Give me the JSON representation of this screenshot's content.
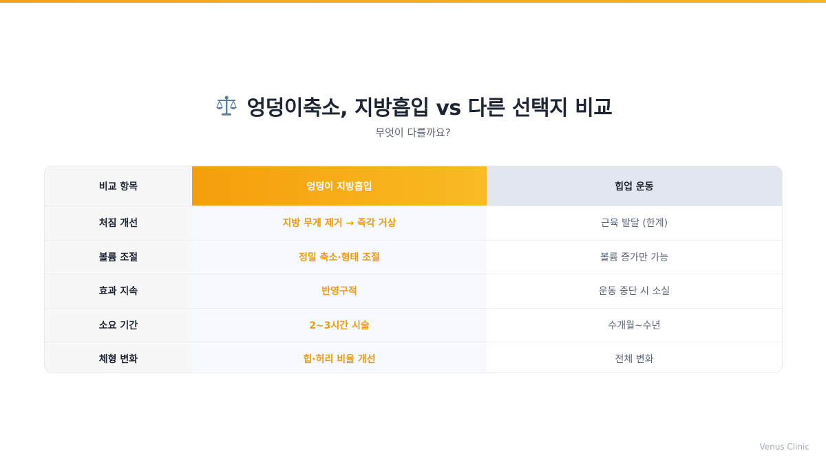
{
  "header": {
    "title": "엉덩이축소, 지방흡입 vs 다른 선택지 비교",
    "title_icon": "scale-icon",
    "subtitle": "무엇이 다를까요?"
  },
  "table": {
    "columns": [
      "비교 항목",
      "엉덩이 지방흡입",
      "힙업 운동"
    ],
    "rows": [
      [
        "처짐 개선",
        "지방 무게 제거 → 즉각 거상",
        "근육 발달 (한계)"
      ],
      [
        "볼륨 조절",
        "정밀 축소·형태 조절",
        "볼륨 증가만 가능"
      ],
      [
        "효과 지속",
        "반영구적",
        "운동 중단 시 소실"
      ],
      [
        "소요 기간",
        "2~3시간 시술",
        "수개월~수년"
      ],
      [
        "체형 변화",
        "힙·허리 비율 개선",
        "전체 변화"
      ]
    ]
  },
  "footer": {
    "brand": "Venus Clinic"
  },
  "colors": {
    "accent": "#f5a31a",
    "accent_text": "#ef9b12",
    "dark_text": "#1e2533",
    "muted_text": "#5b6678"
  }
}
